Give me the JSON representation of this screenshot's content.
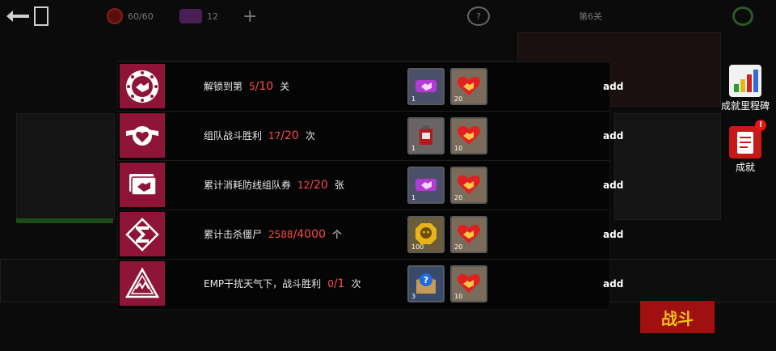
{
  "topbar": {
    "energy": "60/60",
    "tickets": "12",
    "plus": "+",
    "help": "?",
    "level_title": "第6关"
  },
  "rows": [
    {
      "prefix": "解锁到第",
      "current": "5",
      "total": "/10",
      "unit": "关",
      "badge_icon": "handshake-stars-icon",
      "rewards": [
        {
          "icon": "ticket-icon",
          "qty": "1"
        },
        {
          "icon": "heart-handshake-icon",
          "qty": "20"
        }
      ],
      "action": "add"
    },
    {
      "prefix": "组队战斗胜利",
      "current": "17",
      "total": "/20",
      "unit": "次",
      "badge_icon": "winged-heart-icon",
      "rewards": [
        {
          "icon": "fuel-can-icon",
          "qty": "1"
        },
        {
          "icon": "heart-handshake-icon",
          "qty": "10"
        }
      ],
      "action": "add"
    },
    {
      "prefix": "累计消耗防线组队券",
      "current": "12",
      "total": "/20",
      "unit": "张",
      "badge_icon": "ticket-stack-icon",
      "rewards": [
        {
          "icon": "ticket-icon",
          "qty": "1"
        },
        {
          "icon": "heart-handshake-icon",
          "qty": "20"
        }
      ],
      "action": "add"
    },
    {
      "prefix": "累计击杀僵尸",
      "current": "2588",
      "total": "/4000",
      "unit": "个",
      "badge_icon": "sigma-icon",
      "rewards": [
        {
          "icon": "skull-coin-icon",
          "qty": "100"
        },
        {
          "icon": "heart-handshake-icon",
          "qty": "20"
        }
      ],
      "action": "add"
    },
    {
      "prefix": "EMP干扰天气下，战斗胜利",
      "current": "0",
      "total": "/1",
      "unit": "次",
      "badge_icon": "lightning-triangle-icon",
      "rewards": [
        {
          "icon": "mystery-box-icon",
          "qty": "3"
        },
        {
          "icon": "heart-handshake-icon",
          "qty": "10"
        }
      ],
      "action": "add"
    }
  ],
  "side": {
    "milestone_label": "成就里程碑",
    "achievement_label": "成就",
    "notice": "!"
  },
  "banner": "战斗"
}
